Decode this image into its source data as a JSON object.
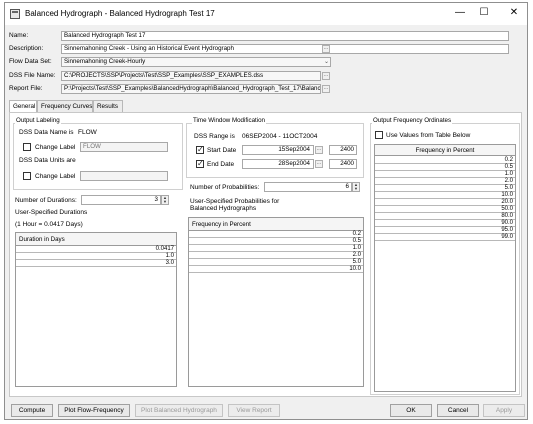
{
  "window": {
    "title": "Balanced Hydrograph -  Balanced Hydrograph Test 17",
    "minimize": "—",
    "maximize": "☐",
    "close": "✕"
  },
  "form": {
    "name_label": "Name:",
    "name_value": "Balanced Hydrograph Test 17",
    "description_label": "Description:",
    "description_value": "Sinnemahoning Creek - Using an Historical Event Hydrograph",
    "flow_label": "Flow Data Set:",
    "flow_value": "Sinnemahoning Creek-Hourly",
    "dss_label": "DSS File Name:",
    "dss_value": "C:\\PROJECTS\\SSP\\Projects\\Test\\SSP_Examples\\SSP_EXAMPLES.dss",
    "report_label": "Report File:",
    "report_value": "P:\\Projects\\Test\\SSP_Examples\\BalancedHydrograph\\Balanced_Hydrograph_Test_17\\Balance...",
    "browse_glyph": "..."
  },
  "tabs": [
    "General",
    "Frequency Curves",
    "Results"
  ],
  "output_labeling": {
    "title": "Output Labeling",
    "dss_name_label": "DSS Data Name is",
    "dss_name_value": "FLOW",
    "change_label_1": "Change Label",
    "change_field_1": "FLOW",
    "dss_units_label": "DSS Data Units are",
    "change_label_2": "Change Label",
    "change_field_2": ""
  },
  "durations": {
    "number_label": "Number of Durations:",
    "number_value": "3",
    "user_label": "User-Specified Durations",
    "hour_note": "(1 Hour = 0.0417 Days)",
    "column": "Duration in Days",
    "values": [
      "0.0417",
      "1.0",
      "3.0"
    ]
  },
  "time_window": {
    "title": "Time Window Modification",
    "range_label": "DSS Range is",
    "range_value": "06SEP2004 - 11OCT2004",
    "start_label": "Start Date",
    "start_date": "15Sep2004",
    "start_time": "2400",
    "end_label": "End Date",
    "end_date": "28Sep2004",
    "end_time": "2400"
  },
  "probabilities": {
    "number_label": "Number of Probabilities:",
    "number_value": "6",
    "user_label_1": "User-Specified Probabilities for",
    "user_label_2": "Balanced Hydrographs",
    "column": "Frequency in Percent",
    "values": [
      "0.2",
      "0.5",
      "1.0",
      "2.0",
      "5.0",
      "10.0"
    ]
  },
  "ordinates": {
    "title": "Output Frequency Ordinates",
    "use_label": "Use Values from Table Below",
    "column": "Frequency in Percent",
    "values": [
      "0.2",
      "0.5",
      "1.0",
      "2.0",
      "5.0",
      "10.0",
      "20.0",
      "50.0",
      "80.0",
      "90.0",
      "95.0",
      "99.0"
    ]
  },
  "buttons": {
    "compute": "Compute",
    "plot_flow": "Plot Flow-Frequency",
    "plot_balanced": "Plot Balanced Hydrograph",
    "view_report": "View Report",
    "ok": "OK",
    "cancel": "Cancel",
    "apply": "Apply"
  }
}
